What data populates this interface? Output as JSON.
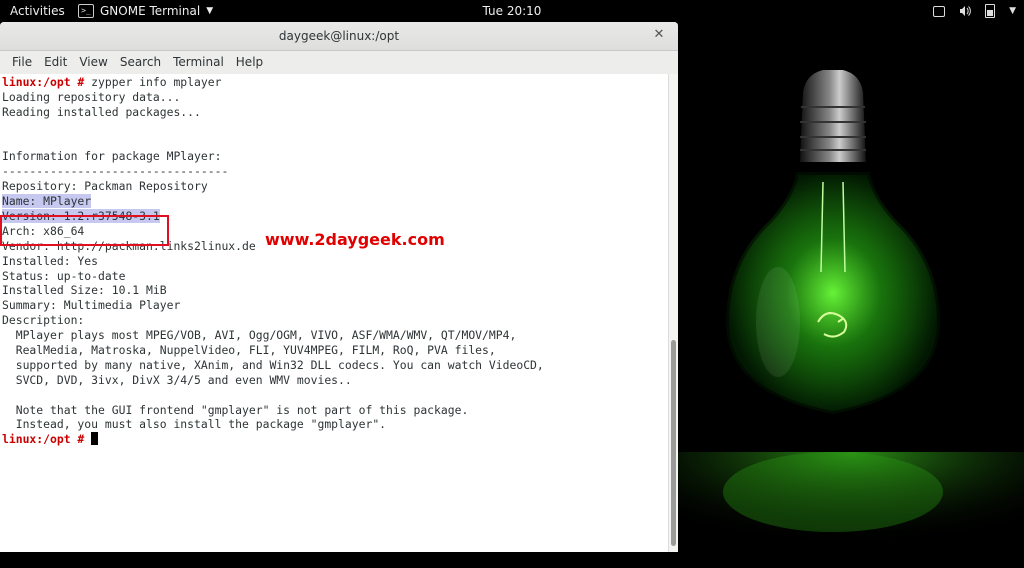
{
  "topbar": {
    "activities": "Activities",
    "app_name": "GNOME Terminal",
    "clock": "Tue 20:10",
    "icons": [
      "screen-icon",
      "volume-icon",
      "battery-icon",
      "system-menu-caret-icon"
    ]
  },
  "window": {
    "title": "daygeek@linux:/opt",
    "menu": [
      "File",
      "Edit",
      "View",
      "Search",
      "Terminal",
      "Help"
    ]
  },
  "terminal": {
    "prompt": "linux:/opt #",
    "lines": [
      {
        "prompt": "linux:/opt #",
        "text": " zypper info mplayer"
      },
      {
        "text": "Loading repository data..."
      },
      {
        "text": "Reading installed packages..."
      },
      {
        "text": ""
      },
      {
        "text": ""
      },
      {
        "text": "Information for package MPlayer:"
      },
      {
        "text": "---------------------------------"
      },
      {
        "text": "Repository: Packman Repository"
      },
      {
        "text": "Name: MPlayer",
        "highlight": true
      },
      {
        "text": "Version: 1.2.r37548-3.1",
        "highlight": true
      },
      {
        "text": "Arch: x86_64"
      },
      {
        "text": "Vendor: http://packman.links2linux.de"
      },
      {
        "text": "Installed: Yes"
      },
      {
        "text": "Status: up-to-date"
      },
      {
        "text": "Installed Size: 10.1 MiB"
      },
      {
        "text": "Summary: Multimedia Player"
      },
      {
        "text": "Description:"
      },
      {
        "text": "  MPlayer plays most MPEG/VOB, AVI, Ogg/OGM, VIVO, ASF/WMA/WMV, QT/MOV/MP4,"
      },
      {
        "text": "  RealMedia, Matroska, NuppelVideo, FLI, YUV4MPEG, FILM, RoQ, PVA files,"
      },
      {
        "text": "  supported by many native, XAnim, and Win32 DLL codecs. You can watch VideoCD,"
      },
      {
        "text": "  SVCD, DVD, 3ivx, DivX 3/4/5 and even WMV movies.."
      },
      {
        "text": ""
      },
      {
        "text": "  Note that the GUI frontend \"gmplayer\" is not part of this package."
      },
      {
        "text": "  Instead, you must also install the package \"gmplayer\"."
      },
      {
        "prompt": "linux:/opt #",
        "text": " ",
        "cursor": true
      }
    ]
  },
  "watermark": "www.2daygeek.com",
  "colors": {
    "prompt": "#cc0000",
    "highlight_bg": "#c6c8f0",
    "annotation_box": "#e01020",
    "watermark": "#e00000"
  }
}
